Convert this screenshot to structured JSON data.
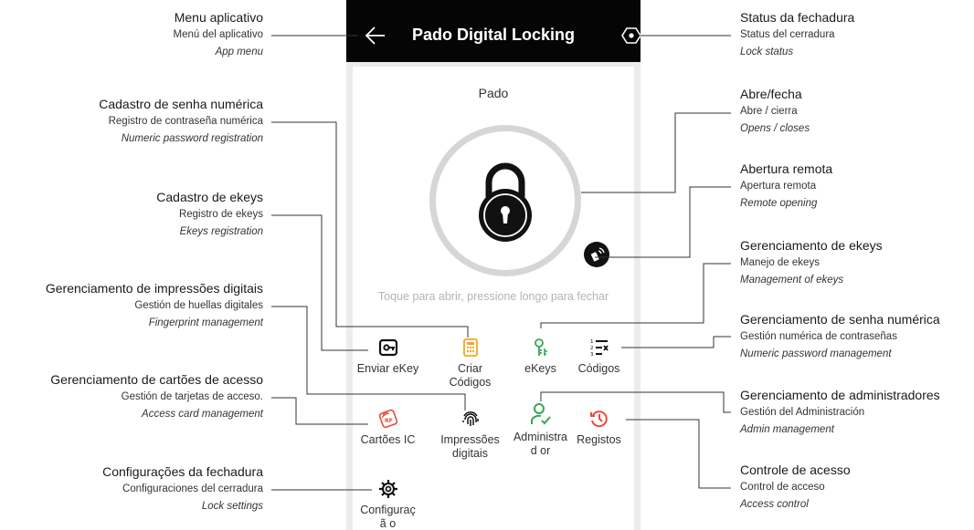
{
  "app": {
    "title": "Pado Digital Locking",
    "device_name": "Pado",
    "hint": "Toque para abrir, pressione longo para fechar"
  },
  "grid": [
    {
      "label": "Enviar eKey",
      "icon": "send-ekey-icon",
      "color": "#111111"
    },
    {
      "label": "Criar Códigos",
      "icon": "calculator-icon",
      "color": "#f5a623"
    },
    {
      "label": "eKeys",
      "icon": "ekeys-icon",
      "color": "#34a853"
    },
    {
      "label": "Códigos",
      "icon": "numbered-list-icon",
      "color": "#111111"
    },
    {
      "label": "Cartões IC",
      "icon": "rf-card-icon",
      "color": "#e94b3c"
    },
    {
      "label": "Impressões digitais",
      "icon": "fingerprint-icon",
      "color": "#111111"
    },
    {
      "label": "Administrad or",
      "icon": "admin-user-icon",
      "color": "#34a853"
    },
    {
      "label": "Registos",
      "icon": "history-clock-icon",
      "color": "#e94b3c"
    },
    {
      "label": "Configuraçã o",
      "icon": "gear-icon",
      "color": "#111111"
    }
  ],
  "annotations": {
    "left": [
      {
        "pt": "Menu aplicativo",
        "es": "Menú del aplicativo",
        "en": "App menu"
      },
      {
        "pt": "Cadastro de senha numérica",
        "es": "Registro de contraseña numérica",
        "en": "Numeric password registration"
      },
      {
        "pt": "Cadastro de ekeys",
        "es": "Registro de ekeys",
        "en": "Ekeys registration"
      },
      {
        "pt": "Gerenciamento de impressões digitais",
        "es": "Gestión de huellas digitales",
        "en": "Fingerprint management"
      },
      {
        "pt": "Gerenciamento de cartões de acesso",
        "es": "Gestión de tarjetas de acceso.",
        "en": "Access card management"
      },
      {
        "pt": "Configurações da fechadura",
        "es": "Configuraciones del cerradura",
        "en": "Lock settings"
      }
    ],
    "right": [
      {
        "pt": "Status da fechadura",
        "es": "Status del cerradura",
        "en": "Lock status"
      },
      {
        "pt": "Abre/fecha",
        "es": "Abre / cierra",
        "en": "Opens / closes"
      },
      {
        "pt": "Abertura remota",
        "es": "Apertura remota",
        "en": "Remote opening"
      },
      {
        "pt": "Gerenciamento de ekeys",
        "es": "Manejo de ekeys",
        "en": "Management of ekeys"
      },
      {
        "pt": "Gerenciamento de senha numérica",
        "es": "Gestión numérica de contraseñas",
        "en": "Numeric password management"
      },
      {
        "pt": "Gerenciamento de administradores",
        "es": "Gestión del Administración",
        "en": "Admin management"
      },
      {
        "pt": "Controle de acesso",
        "es": "Control de acceso",
        "en": "Access control"
      }
    ]
  },
  "colors": {
    "appbar": "#050505",
    "green": "#34a853",
    "orange": "#f5a623",
    "red": "#e94b3c"
  }
}
